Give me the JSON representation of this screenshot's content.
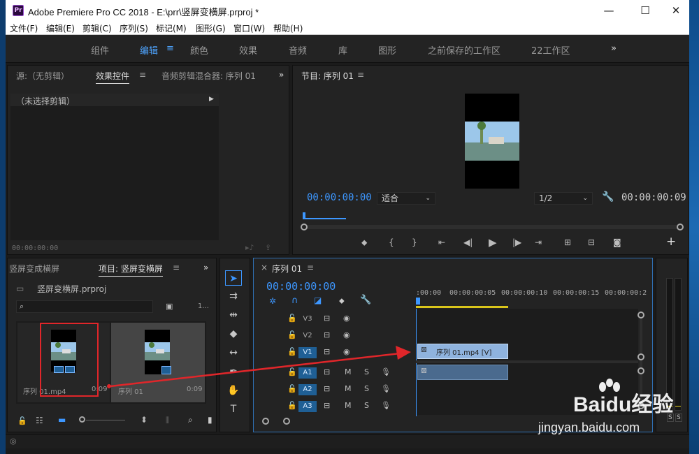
{
  "window": {
    "title": "Adobe Premiere Pro CC 2018 - E:\\prr\\竖屏变横屏.prproj *",
    "app_icon": "Pr",
    "controls": {
      "minimize": "—",
      "maximize": "☐",
      "close": "✕"
    }
  },
  "menu": [
    "文件(F)",
    "编辑(E)",
    "剪辑(C)",
    "序列(S)",
    "标记(M)",
    "图形(G)",
    "窗口(W)",
    "帮助(H)"
  ],
  "workspaces": {
    "items": [
      "组件",
      "编辑",
      "颜色",
      "效果",
      "音频",
      "库",
      "图形",
      "之前保存的工作区",
      "22工作区"
    ],
    "active": "编辑",
    "menu_glyph": "≡",
    "overflow": "»"
  },
  "source_panel": {
    "tabs": [
      "源:（无剪辑）",
      "效果控件",
      "音频剪辑混合器: 序列 01"
    ],
    "active_tab": "效果控件",
    "tab_menu_glyph": "≡",
    "no_clip_label": "（未选择剪辑）",
    "timecode": "00:00:00:00",
    "overflow": "»"
  },
  "program_panel": {
    "title": "节目: 序列 01",
    "menu_glyph": "≡",
    "timecode": "00:00:00:00",
    "fit_label": "适合",
    "resolution": "1/2",
    "duration": "00:00:00:09",
    "add_button": "+"
  },
  "project_panel": {
    "tabs": [
      "竖屏变成横屏",
      "项目: 竖屏变横屏"
    ],
    "menu_glyph": "≡",
    "overflow": "»",
    "project_file": "竖屏变横屏.prproj",
    "item_count": "1...",
    "items": [
      {
        "name": "序列 01.mp4",
        "duration": "0:09"
      },
      {
        "name": "序列 01",
        "duration": "0:09"
      }
    ]
  },
  "timeline": {
    "tab": "序列 01",
    "close": "×",
    "menu_glyph": "≡",
    "timecode": "00:00:00:00",
    "ruler": [
      ":00:00",
      "00:00:00:05",
      "00:00:00:10",
      "00:00:00:15",
      "00:00:00:2"
    ],
    "video_tracks": [
      "V3",
      "V2",
      "V1"
    ],
    "audio_tracks": [
      "A1",
      "A2",
      "A3"
    ],
    "mute_label": "M",
    "solo_label": "S",
    "clip_label": "序列 01.mp4 [V]"
  },
  "audio_meter": {
    "labels": [
      "S",
      "S"
    ]
  },
  "watermark": {
    "main": "Baidu经验",
    "sub": "jingyan.baidu.com"
  },
  "colors": {
    "accent": "#3d97ff",
    "annotation": "#e0262a",
    "clip": "#8fb3de"
  }
}
